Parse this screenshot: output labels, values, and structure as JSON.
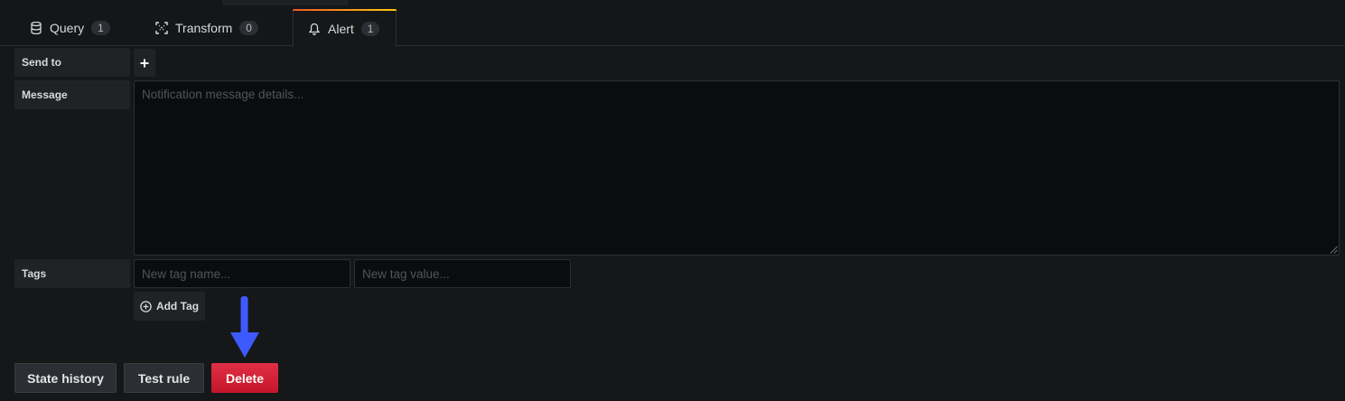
{
  "tabs": [
    {
      "label": "Query",
      "count": "1",
      "icon": "database-icon"
    },
    {
      "label": "Transform",
      "count": "0",
      "icon": "transform-icon"
    },
    {
      "label": "Alert",
      "count": "1",
      "icon": "bell-icon"
    }
  ],
  "notifications": {
    "send_to_label": "Send to",
    "add_icon": "plus-icon",
    "message_label": "Message",
    "message_placeholder": "Notification message details...",
    "message_value": ""
  },
  "tags": {
    "label": "Tags",
    "name_placeholder": "New tag name...",
    "value_placeholder": "New tag value...",
    "add_tag_label": "Add Tag",
    "add_tag_icon": "plus-circle-icon"
  },
  "actions": {
    "state_history": "State history",
    "test_rule": "Test rule",
    "delete": "Delete"
  },
  "annotation": {
    "arrow_color": "#3d5afe",
    "arrow_icon": "arrow-down-icon"
  },
  "colors": {
    "background": "#161719",
    "danger": "#e02f44",
    "tab_accent_start": "#f05a28",
    "tab_accent_end": "#fbca0a"
  }
}
